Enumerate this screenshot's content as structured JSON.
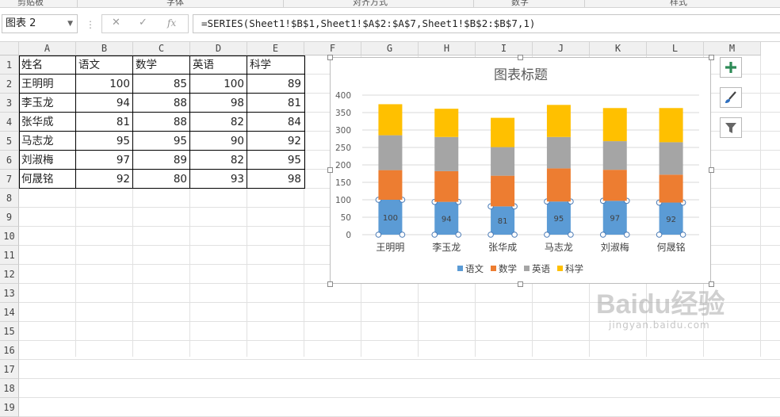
{
  "ribbon": {
    "groups": [
      "剪贴板",
      "字体",
      "对齐方式",
      "数字",
      "样式"
    ]
  },
  "formula_bar": {
    "name_box": "图表 2",
    "cancel_icon": "✕",
    "enter_icon": "✓",
    "fx_label": "fx",
    "formula": "=SERIES(Sheet1!$B$1,Sheet1!$A$2:$A$7,Sheet1!$B$2:$B$7,1)"
  },
  "sheet": {
    "columns": [
      "A",
      "B",
      "C",
      "D",
      "E",
      "F",
      "G",
      "H",
      "I",
      "J",
      "K",
      "L",
      "M"
    ],
    "rows": [
      "1",
      "2",
      "3",
      "4",
      "5",
      "6",
      "7",
      "8",
      "9",
      "10",
      "11",
      "12",
      "13",
      "14",
      "15",
      "16",
      "17",
      "18",
      "19"
    ],
    "table": {
      "headers": [
        "姓名",
        "语文",
        "数学",
        "英语",
        "科学"
      ],
      "records": [
        {
          "name": "王明明",
          "values": [
            100,
            85,
            100,
            89
          ]
        },
        {
          "name": "李玉龙",
          "values": [
            94,
            88,
            98,
            81
          ]
        },
        {
          "name": "张华成",
          "values": [
            81,
            88,
            82,
            84
          ]
        },
        {
          "name": "马志龙",
          "values": [
            95,
            95,
            90,
            92
          ]
        },
        {
          "name": "刘淑梅",
          "values": [
            97,
            89,
            82,
            95
          ]
        },
        {
          "name": "何晟铭",
          "values": [
            92,
            80,
            93,
            98
          ]
        }
      ]
    }
  },
  "chart_data": {
    "type": "bar",
    "stacked": true,
    "title": "图表标题",
    "categories": [
      "王明明",
      "李玉龙",
      "张华成",
      "马志龙",
      "刘淑梅",
      "何晟铭"
    ],
    "series": [
      {
        "name": "语文",
        "color": "#5b9bd5",
        "values": [
          100,
          94,
          81,
          95,
          97,
          92
        ]
      },
      {
        "name": "数学",
        "color": "#ed7d31",
        "values": [
          85,
          88,
          88,
          95,
          89,
          80
        ]
      },
      {
        "name": "英语",
        "color": "#a5a5a5",
        "values": [
          100,
          98,
          82,
          90,
          82,
          93
        ]
      },
      {
        "name": "科学",
        "color": "#ffc000",
        "values": [
          89,
          81,
          84,
          92,
          95,
          98
        ]
      }
    ],
    "yticks": [
      "0",
      "50",
      "100",
      "150",
      "200",
      "250",
      "300",
      "350",
      "400"
    ],
    "ylim": [
      0,
      400
    ],
    "data_labels": [
      "100",
      "94",
      "81",
      "95",
      "97",
      "92"
    ],
    "selected_series": "语文",
    "legend_position": "bottom",
    "grid": true
  },
  "chart_tools": {
    "add_element_icon": "plus-icon",
    "styles_icon": "brush-icon",
    "filter_icon": "filter-icon"
  },
  "watermark": {
    "brand": "Baidu经验",
    "url": "jingyan.baidu.com"
  }
}
